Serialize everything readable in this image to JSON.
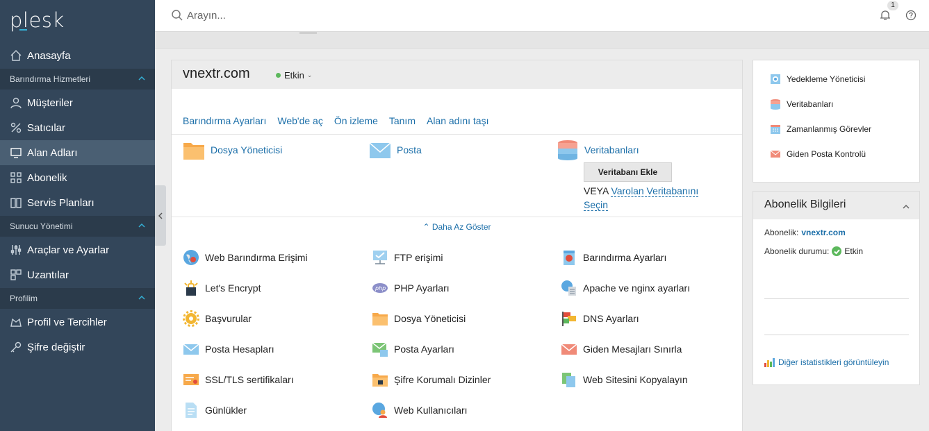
{
  "app": {
    "logo_text": "plesk"
  },
  "sidebar": {
    "items": [
      {
        "label": "Anasayfa",
        "icon": "home-icon"
      },
      {
        "label": "Müşteriler",
        "icon": "user-icon"
      },
      {
        "label": "Satıcılar",
        "icon": "percent-icon"
      },
      {
        "label": "Alan Adları",
        "icon": "monitor-icon"
      },
      {
        "label": "Abonelik",
        "icon": "grid-icon"
      },
      {
        "label": "Servis Planları",
        "icon": "book-icon"
      },
      {
        "label": "Araçlar ve Ayarlar",
        "icon": "sliders-icon"
      },
      {
        "label": "Uzantılar",
        "icon": "extensions-icon"
      },
      {
        "label": "Profil ve Tercihler",
        "icon": "profile-icon"
      },
      {
        "label": "Şifre değiştir",
        "icon": "key-icon"
      }
    ],
    "sections": [
      "Barındırma Hizmetleri",
      "Sunucu Yönetimi",
      "Profilim"
    ],
    "active_item": "Alan Adları"
  },
  "topbar": {
    "search_placeholder": "Arayın...",
    "notification_count": "1"
  },
  "domain": {
    "name": "vnextr.com",
    "status": "Etkin",
    "links": [
      "Barındırma Ayarları",
      "Web'de aç",
      "Ön izleme",
      "Tanım",
      "Alan adını taşı"
    ],
    "primary": {
      "file_manager": "Dosya Yöneticisi",
      "mail": "Posta",
      "databases": "Veritabanları",
      "add_db_button": "Veritabanı Ekle",
      "or_text": "VEYA",
      "select_db_link": "Varolan Veritabanını Seçin"
    },
    "show_less": "Daha Az Göster",
    "tools": [
      [
        "Web Barındırma Erişimi",
        "FTP erişimi",
        "Barındırma Ayarları"
      ],
      [
        "Let's Encrypt",
        "PHP Ayarları",
        "Apache ve nginx ayarları"
      ],
      [
        "Başvurular",
        "Dosya Yöneticisi",
        "DNS Ayarları"
      ],
      [
        "Posta Hesapları",
        "Posta Ayarları",
        "Giden Mesajları Sınırla"
      ],
      [
        "SSL/TLS sertifikaları",
        "Şifre Korumalı Dizinler",
        "Web Sitesini Kopyalayın"
      ],
      [
        "Günlükler",
        "Web Kullanıcıları"
      ]
    ]
  },
  "right_panel": {
    "items": [
      "Yedekleme Yöneticisi",
      "Veritabanları",
      "Zamanlanmış Görevler",
      "Giden Posta Kontrolü"
    ]
  },
  "subscription_panel": {
    "title": "Abonelik Bilgileri",
    "subscription_label": "Abonelik:",
    "subscription_value": "vnextr.com",
    "status_label": "Abonelik durumu:",
    "status_value": "Etkin",
    "stats_link": "Diğer istatistikleri görüntüleyin"
  },
  "colors": {
    "sidebar": "#33465a",
    "accent": "#34b0d6",
    "link": "#1c6fa9",
    "ok": "#5cb85c"
  }
}
